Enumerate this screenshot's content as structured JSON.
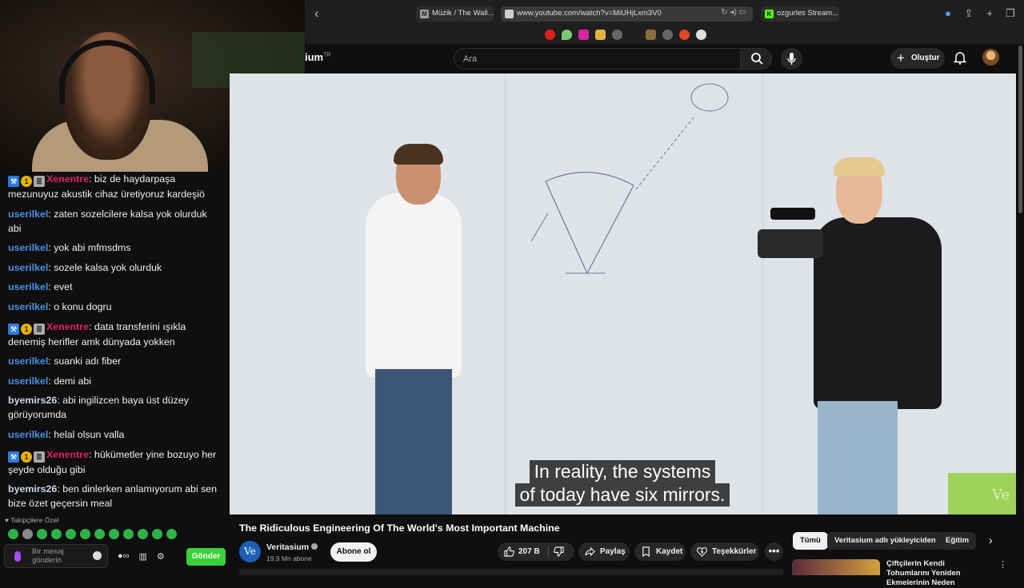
{
  "browser": {
    "tabs": [
      {
        "label": "Müzik / The Wall...",
        "favicon": "M",
        "favicon_color": "#9aa0a6"
      },
      {
        "label": "www.youtube.com/watch?v=MiUHjLxm3V0",
        "favicon": "",
        "favicon_color": "#cfcfcf"
      },
      {
        "label": "ozgurles Stream...",
        "favicon": "K",
        "favicon_color": "#53fc18"
      }
    ]
  },
  "youtube": {
    "logo_text": "ium",
    "logo_region": "TR",
    "search_placeholder": "Ara",
    "create_label": "Oluştur"
  },
  "chat": {
    "messages": [
      {
        "user": "Xenentre",
        "user_color": "#e0245e",
        "badges": true,
        "text": "biz de haydarpaşa mezunuyuz akustik cihaz üretiyoruz kardeşiö"
      },
      {
        "user": "userilkel",
        "user_color": "#4a90e2",
        "badges": false,
        "text": "zaten sozelcilere kalsa yok olurduk abi"
      },
      {
        "user": "userilkel",
        "user_color": "#4a90e2",
        "badges": false,
        "text": "yok abi mfmsdms"
      },
      {
        "user": "userilkel",
        "user_color": "#4a90e2",
        "badges": false,
        "text": "sozele kalsa yok olurduk"
      },
      {
        "user": "userilkel",
        "user_color": "#4a90e2",
        "badges": false,
        "text": "evet"
      },
      {
        "user": "userilkel",
        "user_color": "#4a90e2",
        "badges": false,
        "text": "o konu dogru"
      },
      {
        "user": "Xenentre",
        "user_color": "#e0245e",
        "badges": true,
        "text": "data transferini ışıkla denemiş herifler amk dünyada yokken"
      },
      {
        "user": "userilkel",
        "user_color": "#4a90e2",
        "badges": false,
        "text": "suanki adı fiber"
      },
      {
        "user": "userilkel",
        "user_color": "#4a90e2",
        "badges": false,
        "text": "demi abi"
      },
      {
        "user": "byemirs26",
        "user_color": "#c9d4e8",
        "badges": false,
        "text": "abi ingilizcen baya üst düzey görüyorumda"
      },
      {
        "user": "userilkel",
        "user_color": "#4a90e2",
        "badges": false,
        "text": "helal olsun valla"
      },
      {
        "user": "Xenentre",
        "user_color": "#e0245e",
        "badges": true,
        "text": "hükümetler yine bozuyo her şeyde olduğu gibi"
      },
      {
        "user": "byemirs26",
        "user_color": "#c9d4e8",
        "badges": false,
        "text": "ben dinlerken anlamıyorum abi sen bize özet geçersin meal"
      }
    ],
    "badge_number": "1",
    "followers_only": "Takipçilere Özel",
    "input_placeholder": "Bir mesaj gönderin",
    "send_label": "Gönder"
  },
  "video": {
    "subtitle_line1": "In reality, the systems",
    "subtitle_line2": "of today have six mirrors.",
    "watermark": "Ve",
    "title": "The Ridiculous Engineering Of The World's Most Important Machine"
  },
  "channel": {
    "name": "Veritasium",
    "avatar_text": "Ve",
    "subscribers": "19,9 Mn abone",
    "subscribe_label": "Abone ol"
  },
  "actions": {
    "likes": "207 B",
    "share": "Paylaş",
    "save": "Kaydet",
    "thanks": "Teşekkürler"
  },
  "chips": [
    "Tümü",
    "Veritasium adlı yükleyiciden",
    "Eğitim"
  ],
  "recommendation": {
    "title": "Çiftçilerin Kendi Tohumlarını Yeniden Ekmelerinin Neden"
  }
}
